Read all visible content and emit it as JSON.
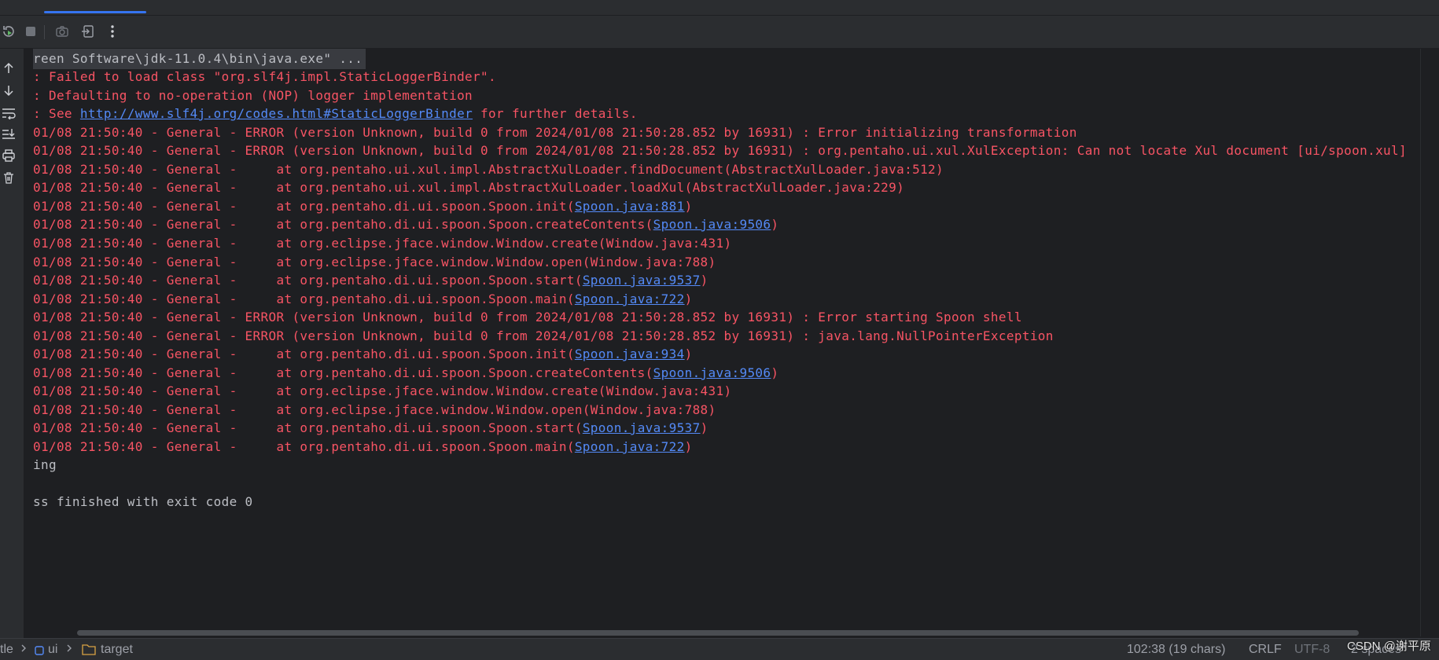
{
  "toolbar": {
    "rerun_icon": "rerun-icon",
    "stop_icon": "stop-icon",
    "camera_icon": "camera-icon",
    "exit_icon": "exit-icon",
    "more_icon": "more-vertical-icon"
  },
  "rail": [
    "arrow-up-icon",
    "arrow-down-icon",
    "soft-wrap-icon",
    "scroll-to-end-icon",
    "print-icon",
    "trash-icon"
  ],
  "console": {
    "command": "reen Software\\jdk-11.0.4\\bin\\java.exe\" ...",
    "slf4j_1": ": Failed to load class \"org.slf4j.impl.StaticLoggerBinder\".",
    "slf4j_2": ": Defaulting to no-operation (NOP) logger implementation",
    "slf4j_3_pre": ": See ",
    "slf4j_3_link": "http://www.slf4j.org/codes.html#StaticLoggerBinder",
    "slf4j_3_post": " for further details.",
    "prefix": "01/08 21:50:40 - General - ",
    "err1": "ERROR (version Unknown, build 0 from 2024/01/08 21:50:28.852 by 16931) : Error initializing transformation",
    "err2": "ERROR (version Unknown, build 0 from 2024/01/08 21:50:28.852 by 16931) : org.pentaho.ui.xul.XulException: Can not locate Xul document [ui/spoon.xul]",
    "s1": "    at org.pentaho.ui.xul.impl.AbstractXulLoader.findDocument(AbstractXulLoader.java:512)",
    "s2": "    at org.pentaho.ui.xul.impl.AbstractXulLoader.loadXul(AbstractXulLoader.java:229)",
    "s3_pre": "    at org.pentaho.di.ui.spoon.Spoon.init(",
    "s3_link": "Spoon.java:881",
    "s4_pre": "    at org.pentaho.di.ui.spoon.Spoon.createContents(",
    "s4_link": "Spoon.java:9506",
    "s5": "    at org.eclipse.jface.window.Window.create(Window.java:431)",
    "s6": "    at org.eclipse.jface.window.Window.open(Window.java:788)",
    "s7_pre": "    at org.pentaho.di.ui.spoon.Spoon.start(",
    "s7_link": "Spoon.java:9537",
    "s8_pre": "    at org.pentaho.di.ui.spoon.Spoon.main(",
    "s8_link": "Spoon.java:722",
    "err3": "ERROR (version Unknown, build 0 from 2024/01/08 21:50:28.852 by 16931) : Error starting Spoon shell",
    "err4": "ERROR (version Unknown, build 0 from 2024/01/08 21:50:28.852 by 16931) : java.lang.NullPointerException",
    "t1_pre": "    at org.pentaho.di.ui.spoon.Spoon.init(",
    "t1_link": "Spoon.java:934",
    "t2_pre": "    at org.pentaho.di.ui.spoon.Spoon.createContents(",
    "t2_link": "Spoon.java:9506",
    "t3": "    at org.eclipse.jface.window.Window.create(Window.java:431)",
    "t4": "    at org.eclipse.jface.window.Window.open(Window.java:788)",
    "t5_pre": "    at org.pentaho.di.ui.spoon.Spoon.start(",
    "t5_link": "Spoon.java:9537",
    "t6_pre": "    at org.pentaho.di.ui.spoon.Spoon.main(",
    "t6_link": "Spoon.java:722",
    "close_paren": ")",
    "ending": "ing",
    "finished": "ss finished with exit code 0"
  },
  "status": {
    "crumb1": "tle",
    "crumb2": "ui",
    "crumb3": "target",
    "position": "102:38 (19 chars)",
    "line_sep": "CRLF",
    "encoding": "UTF-8",
    "indent": "2 spaces*"
  },
  "watermark": "CSDN @谢平原",
  "colors": {
    "error": "#f75464",
    "link": "#548af7",
    "text": "#bcbec4",
    "bg": "#1e1f22"
  }
}
